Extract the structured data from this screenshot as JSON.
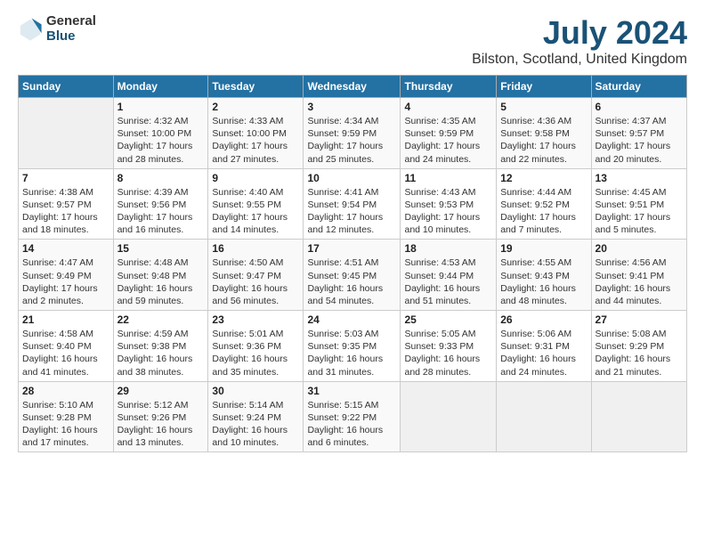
{
  "logo": {
    "general": "General",
    "blue": "Blue"
  },
  "header": {
    "title": "July 2024",
    "subtitle": "Bilston, Scotland, United Kingdom"
  },
  "weekdays": [
    "Sunday",
    "Monday",
    "Tuesday",
    "Wednesday",
    "Thursday",
    "Friday",
    "Saturday"
  ],
  "weeks": [
    [
      {
        "day": "",
        "sunrise": "",
        "sunset": "",
        "daylight": ""
      },
      {
        "day": "1",
        "sunrise": "Sunrise: 4:32 AM",
        "sunset": "Sunset: 10:00 PM",
        "daylight": "Daylight: 17 hours and 28 minutes."
      },
      {
        "day": "2",
        "sunrise": "Sunrise: 4:33 AM",
        "sunset": "Sunset: 10:00 PM",
        "daylight": "Daylight: 17 hours and 27 minutes."
      },
      {
        "day": "3",
        "sunrise": "Sunrise: 4:34 AM",
        "sunset": "Sunset: 9:59 PM",
        "daylight": "Daylight: 17 hours and 25 minutes."
      },
      {
        "day": "4",
        "sunrise": "Sunrise: 4:35 AM",
        "sunset": "Sunset: 9:59 PM",
        "daylight": "Daylight: 17 hours and 24 minutes."
      },
      {
        "day": "5",
        "sunrise": "Sunrise: 4:36 AM",
        "sunset": "Sunset: 9:58 PM",
        "daylight": "Daylight: 17 hours and 22 minutes."
      },
      {
        "day": "6",
        "sunrise": "Sunrise: 4:37 AM",
        "sunset": "Sunset: 9:57 PM",
        "daylight": "Daylight: 17 hours and 20 minutes."
      }
    ],
    [
      {
        "day": "7",
        "sunrise": "Sunrise: 4:38 AM",
        "sunset": "Sunset: 9:57 PM",
        "daylight": "Daylight: 17 hours and 18 minutes."
      },
      {
        "day": "8",
        "sunrise": "Sunrise: 4:39 AM",
        "sunset": "Sunset: 9:56 PM",
        "daylight": "Daylight: 17 hours and 16 minutes."
      },
      {
        "day": "9",
        "sunrise": "Sunrise: 4:40 AM",
        "sunset": "Sunset: 9:55 PM",
        "daylight": "Daylight: 17 hours and 14 minutes."
      },
      {
        "day": "10",
        "sunrise": "Sunrise: 4:41 AM",
        "sunset": "Sunset: 9:54 PM",
        "daylight": "Daylight: 17 hours and 12 minutes."
      },
      {
        "day": "11",
        "sunrise": "Sunrise: 4:43 AM",
        "sunset": "Sunset: 9:53 PM",
        "daylight": "Daylight: 17 hours and 10 minutes."
      },
      {
        "day": "12",
        "sunrise": "Sunrise: 4:44 AM",
        "sunset": "Sunset: 9:52 PM",
        "daylight": "Daylight: 17 hours and 7 minutes."
      },
      {
        "day": "13",
        "sunrise": "Sunrise: 4:45 AM",
        "sunset": "Sunset: 9:51 PM",
        "daylight": "Daylight: 17 hours and 5 minutes."
      }
    ],
    [
      {
        "day": "14",
        "sunrise": "Sunrise: 4:47 AM",
        "sunset": "Sunset: 9:49 PM",
        "daylight": "Daylight: 17 hours and 2 minutes."
      },
      {
        "day": "15",
        "sunrise": "Sunrise: 4:48 AM",
        "sunset": "Sunset: 9:48 PM",
        "daylight": "Daylight: 16 hours and 59 minutes."
      },
      {
        "day": "16",
        "sunrise": "Sunrise: 4:50 AM",
        "sunset": "Sunset: 9:47 PM",
        "daylight": "Daylight: 16 hours and 56 minutes."
      },
      {
        "day": "17",
        "sunrise": "Sunrise: 4:51 AM",
        "sunset": "Sunset: 9:45 PM",
        "daylight": "Daylight: 16 hours and 54 minutes."
      },
      {
        "day": "18",
        "sunrise": "Sunrise: 4:53 AM",
        "sunset": "Sunset: 9:44 PM",
        "daylight": "Daylight: 16 hours and 51 minutes."
      },
      {
        "day": "19",
        "sunrise": "Sunrise: 4:55 AM",
        "sunset": "Sunset: 9:43 PM",
        "daylight": "Daylight: 16 hours and 48 minutes."
      },
      {
        "day": "20",
        "sunrise": "Sunrise: 4:56 AM",
        "sunset": "Sunset: 9:41 PM",
        "daylight": "Daylight: 16 hours and 44 minutes."
      }
    ],
    [
      {
        "day": "21",
        "sunrise": "Sunrise: 4:58 AM",
        "sunset": "Sunset: 9:40 PM",
        "daylight": "Daylight: 16 hours and 41 minutes."
      },
      {
        "day": "22",
        "sunrise": "Sunrise: 4:59 AM",
        "sunset": "Sunset: 9:38 PM",
        "daylight": "Daylight: 16 hours and 38 minutes."
      },
      {
        "day": "23",
        "sunrise": "Sunrise: 5:01 AM",
        "sunset": "Sunset: 9:36 PM",
        "daylight": "Daylight: 16 hours and 35 minutes."
      },
      {
        "day": "24",
        "sunrise": "Sunrise: 5:03 AM",
        "sunset": "Sunset: 9:35 PM",
        "daylight": "Daylight: 16 hours and 31 minutes."
      },
      {
        "day": "25",
        "sunrise": "Sunrise: 5:05 AM",
        "sunset": "Sunset: 9:33 PM",
        "daylight": "Daylight: 16 hours and 28 minutes."
      },
      {
        "day": "26",
        "sunrise": "Sunrise: 5:06 AM",
        "sunset": "Sunset: 9:31 PM",
        "daylight": "Daylight: 16 hours and 24 minutes."
      },
      {
        "day": "27",
        "sunrise": "Sunrise: 5:08 AM",
        "sunset": "Sunset: 9:29 PM",
        "daylight": "Daylight: 16 hours and 21 minutes."
      }
    ],
    [
      {
        "day": "28",
        "sunrise": "Sunrise: 5:10 AM",
        "sunset": "Sunset: 9:28 PM",
        "daylight": "Daylight: 16 hours and 17 minutes."
      },
      {
        "day": "29",
        "sunrise": "Sunrise: 5:12 AM",
        "sunset": "Sunset: 9:26 PM",
        "daylight": "Daylight: 16 hours and 13 minutes."
      },
      {
        "day": "30",
        "sunrise": "Sunrise: 5:14 AM",
        "sunset": "Sunset: 9:24 PM",
        "daylight": "Daylight: 16 hours and 10 minutes."
      },
      {
        "day": "31",
        "sunrise": "Sunrise: 5:15 AM",
        "sunset": "Sunset: 9:22 PM",
        "daylight": "Daylight: 16 hours and 6 minutes."
      },
      {
        "day": "",
        "sunrise": "",
        "sunset": "",
        "daylight": ""
      },
      {
        "day": "",
        "sunrise": "",
        "sunset": "",
        "daylight": ""
      },
      {
        "day": "",
        "sunrise": "",
        "sunset": "",
        "daylight": ""
      }
    ]
  ]
}
